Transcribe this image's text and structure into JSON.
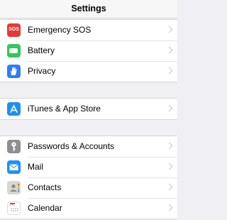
{
  "header": {
    "title": "Settings"
  },
  "groups": [
    {
      "items": [
        {
          "label": "Emergency SOS",
          "icon": "sos-icon",
          "icon_text": "SOS",
          "color": "#e53935"
        },
        {
          "label": "Battery",
          "icon": "battery-icon",
          "color": "#34c759"
        },
        {
          "label": "Privacy",
          "icon": "hand-icon",
          "color": "#2f7df6"
        }
      ]
    },
    {
      "items": [
        {
          "label": "iTunes & App Store",
          "icon": "app-store-icon",
          "color": "#1d8ff2"
        }
      ]
    },
    {
      "items": [
        {
          "label": "Passwords & Accounts",
          "icon": "key-icon",
          "color": "#8e8e93"
        },
        {
          "label": "Mail",
          "icon": "mail-icon",
          "color": "#1e90ff"
        },
        {
          "label": "Contacts",
          "icon": "contacts-icon",
          "color": "#d8d6cf"
        },
        {
          "label": "Calendar",
          "icon": "calendar-icon",
          "color": "#ffffff"
        }
      ]
    }
  ]
}
